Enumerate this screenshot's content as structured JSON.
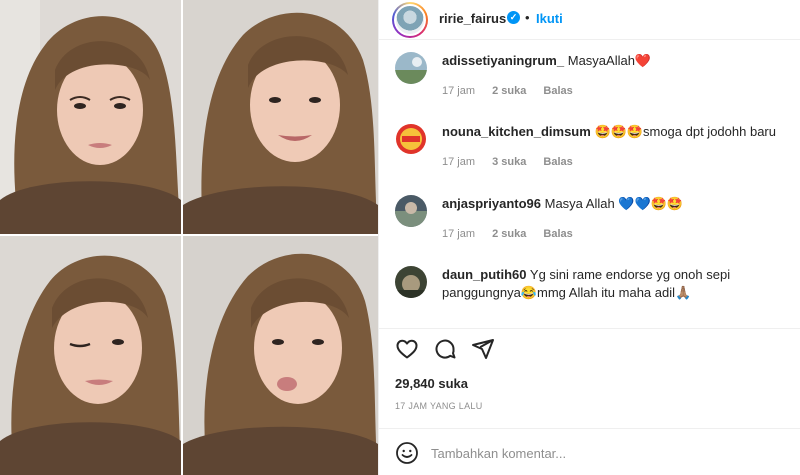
{
  "header": {
    "username": "ririe_fairus",
    "verified_mark": "✓",
    "separator": "•",
    "follow_label": "Ikuti"
  },
  "comments": [
    {
      "username": "adissetiyaningrum_",
      "text": "MasyaAllah❤️",
      "time": "17 jam",
      "likes": "2 suka",
      "reply": "Balas",
      "avatar_icon": "user-avatar-landscape"
    },
    {
      "username": "nouna_kitchen_dimsum",
      "text": "🤩🤩🤩smoga dpt jodohh baru",
      "time": "17 jam",
      "likes": "3 suka",
      "reply": "Balas",
      "avatar_icon": "user-avatar-dimsum-logo"
    },
    {
      "username": "anjaspriyanto96",
      "text": "Masya Allah 💙💙🤩🤩",
      "time": "17 jam",
      "likes": "2 suka",
      "reply": "Balas",
      "avatar_icon": "user-avatar-photo"
    },
    {
      "username": "daun_putih60",
      "text": "Yg sini rame endorse yg onoh sepi panggungnya😂mmg Allah itu maha adil🙏🏽",
      "avatar_icon": "user-avatar-photo"
    }
  ],
  "actions": {
    "like_icon": "heart-icon",
    "comment_icon": "comment-icon",
    "share_icon": "share-icon"
  },
  "post": {
    "likes_count": "29,840 suka",
    "time_ago": "17 JAM YANG LALU"
  },
  "add_comment": {
    "placeholder": "Tambahkan komentar...",
    "emoji_icon": "emoji-icon"
  },
  "colors": {
    "accent": "#0095f6",
    "text": "#262626",
    "muted": "#8e8e8e",
    "border": "#efefef",
    "hijab": "#7a5a3c",
    "background_wall": "#d9d6d2"
  }
}
